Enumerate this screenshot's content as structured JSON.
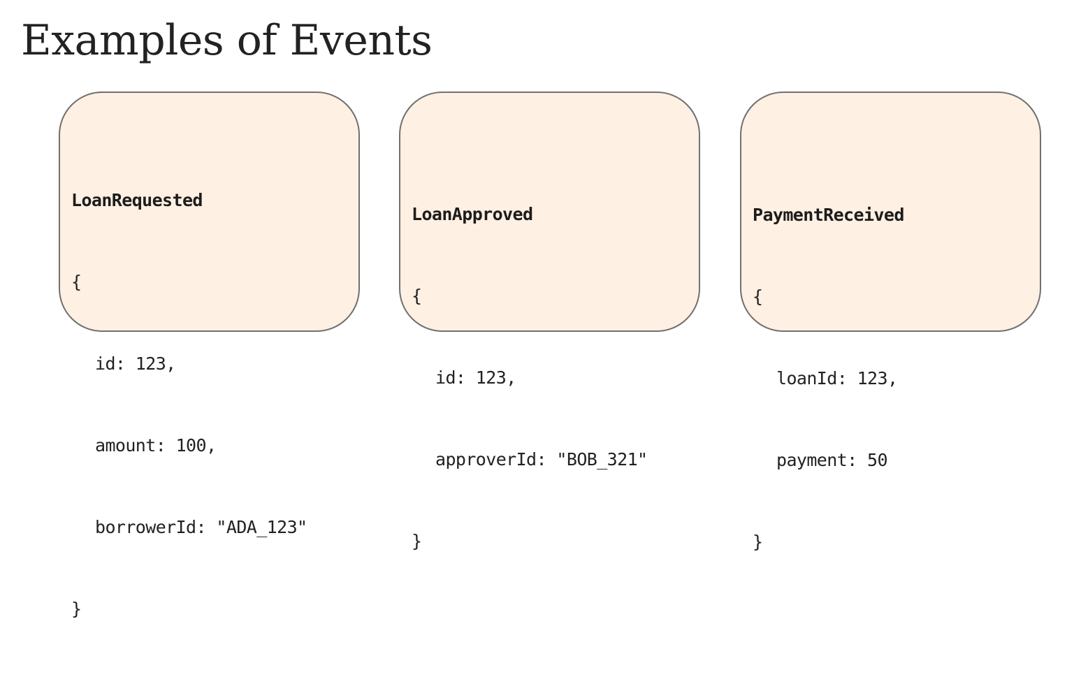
{
  "page": {
    "title": "Examples of Events"
  },
  "events": [
    {
      "name": "LoanRequested",
      "open_brace": "{",
      "fields": [
        "id: 123,",
        "amount: 100,",
        "borrowerId: \"ADA_123\""
      ],
      "close_brace": "}"
    },
    {
      "name": "LoanApproved",
      "open_brace": "{",
      "fields": [
        "id: 123,",
        "approverId: \"BOB_321\""
      ],
      "close_brace": "}"
    },
    {
      "name": "PaymentReceived",
      "open_brace": "{",
      "fields": [
        "loanId: 123,",
        "payment: 50"
      ],
      "close_brace": "}"
    }
  ],
  "colors": {
    "card_background": "#fef0e2",
    "card_border": "#707070",
    "text": "#222222"
  }
}
